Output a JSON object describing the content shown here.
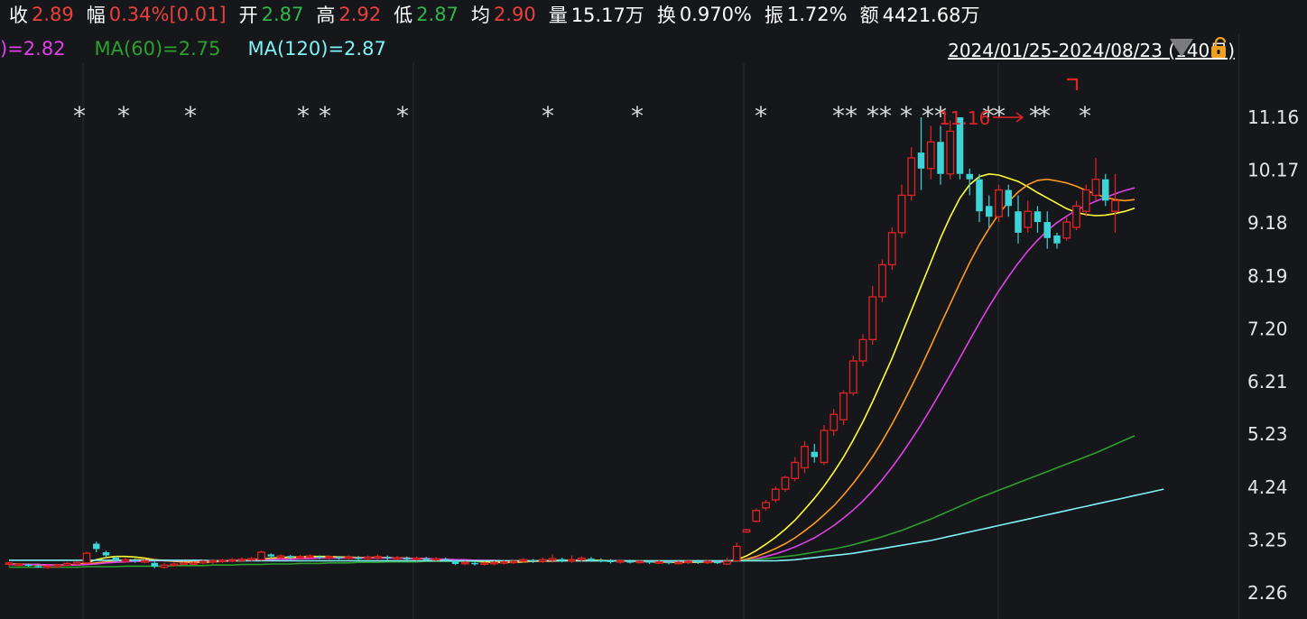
{
  "quote": {
    "close": {
      "label": "收",
      "value": "2.89"
    },
    "change": {
      "label": "幅",
      "value": "0.34%[0.01]"
    },
    "open": {
      "label": "开",
      "value": "2.87"
    },
    "high": {
      "label": "高",
      "value": "2.92"
    },
    "low": {
      "label": "低",
      "value": "2.87"
    },
    "avg": {
      "label": "均",
      "value": "2.90"
    },
    "volume": {
      "label": "量",
      "value": "15.17万"
    },
    "turnover": {
      "label": "换",
      "value": "0.970%"
    },
    "amplitude": {
      "label": "振",
      "value": "1.72%"
    },
    "amount": {
      "label": "额",
      "value": "4421.68万"
    }
  },
  "ma_labels": [
    {
      "text": ")=2.82",
      "color": "#e040e8"
    },
    {
      "text": "MA(60)=2.75",
      "color": "#2ca02c"
    },
    {
      "text": "MA(120)=2.87",
      "color": "#7ef3f7"
    }
  ],
  "range": {
    "label": "2024/01/25-2024/08/23 (140日)"
  },
  "colors": {
    "up": "#e02424",
    "down": "#3ed3d6",
    "up_value": "#e8413c",
    "down_value": "#2fb74a",
    "ma5": "#ffffff",
    "ma10": "#ffff33",
    "ma20": "#ff9a1f",
    "ma30": "#e040e8",
    "ma60": "#2ca02c",
    "ma120": "#7ef3f7",
    "grid": "#2a2b30",
    "marker": "#d8d8d8"
  },
  "chart_data": {
    "type": "candlestick",
    "y_ticks": [
      "11.16",
      "10.17",
      "9.18",
      "8.19",
      "7.20",
      "6.21",
      "5.23",
      "4.24",
      "3.25",
      "2.26"
    ],
    "ylim": [
      2.26,
      11.16
    ],
    "peak_annotation": "11.16",
    "markers": [
      1,
      3,
      6,
      11,
      12,
      16,
      22,
      26,
      31,
      34,
      35,
      36,
      37,
      38,
      39,
      40,
      41,
      42,
      43,
      44,
      45,
      46,
      47,
      48,
      49
    ],
    "candles": [
      [
        2.8,
        2.82,
        2.76,
        2.84
      ],
      [
        2.79,
        2.8,
        2.76,
        2.82
      ],
      [
        2.79,
        2.78,
        2.75,
        2.81
      ],
      [
        2.76,
        2.75,
        2.73,
        2.79
      ],
      [
        2.74,
        2.76,
        2.71,
        2.78
      ],
      [
        2.75,
        2.78,
        2.73,
        2.8
      ],
      [
        2.78,
        2.81,
        2.76,
        2.83
      ],
      [
        2.8,
        2.83,
        2.78,
        2.85
      ],
      [
        2.82,
        3.0,
        2.8,
        3.03
      ],
      [
        3.18,
        3.08,
        3.02,
        3.22
      ],
      [
        3.02,
        2.96,
        2.92,
        3.05
      ],
      [
        2.92,
        2.86,
        2.84,
        2.95
      ],
      [
        2.85,
        2.88,
        2.82,
        2.92
      ],
      [
        2.88,
        2.86,
        2.82,
        2.91
      ],
      [
        2.84,
        2.86,
        2.81,
        2.9
      ],
      [
        2.82,
        2.75,
        2.72,
        2.86
      ],
      [
        2.74,
        2.78,
        2.71,
        2.82
      ],
      [
        2.78,
        2.8,
        2.75,
        2.83
      ],
      [
        2.8,
        2.82,
        2.77,
        2.84
      ],
      [
        2.8,
        2.82,
        2.78,
        2.85
      ],
      [
        2.82,
        2.85,
        2.79,
        2.88
      ],
      [
        2.84,
        2.86,
        2.8,
        2.89
      ],
      [
        2.85,
        2.87,
        2.82,
        2.9
      ],
      [
        2.86,
        2.88,
        2.83,
        2.91
      ],
      [
        2.87,
        2.89,
        2.84,
        2.92
      ],
      [
        2.88,
        2.9,
        2.85,
        2.93
      ],
      [
        2.88,
        3.02,
        2.86,
        3.05
      ],
      [
        2.98,
        2.94,
        2.9,
        3.0
      ],
      [
        2.92,
        2.95,
        2.88,
        2.98
      ],
      [
        2.95,
        2.92,
        2.88,
        2.97
      ],
      [
        2.92,
        2.94,
        2.89,
        2.97
      ],
      [
        2.93,
        2.95,
        2.9,
        2.98
      ],
      [
        2.94,
        2.92,
        2.89,
        2.96
      ],
      [
        2.92,
        2.94,
        2.88,
        2.96
      ],
      [
        2.93,
        2.91,
        2.88,
        2.95
      ],
      [
        2.91,
        2.93,
        2.88,
        2.96
      ],
      [
        2.92,
        2.9,
        2.87,
        2.95
      ],
      [
        2.9,
        2.93,
        2.87,
        2.96
      ],
      [
        2.92,
        2.94,
        2.88,
        2.98
      ],
      [
        2.93,
        2.91,
        2.87,
        2.96
      ],
      [
        2.9,
        2.92,
        2.87,
        2.95
      ],
      [
        2.91,
        2.89,
        2.86,
        2.94
      ],
      [
        2.89,
        2.91,
        2.86,
        2.94
      ],
      [
        2.9,
        2.88,
        2.85,
        2.93
      ],
      [
        2.88,
        2.9,
        2.85,
        2.93
      ],
      [
        2.89,
        2.87,
        2.84,
        2.92
      ],
      [
        2.86,
        2.8,
        2.78,
        2.88
      ],
      [
        2.81,
        2.83,
        2.78,
        2.86
      ],
      [
        2.82,
        2.8,
        2.77,
        2.85
      ],
      [
        2.8,
        2.82,
        2.77,
        2.84
      ],
      [
        2.81,
        2.83,
        2.78,
        2.86
      ],
      [
        2.82,
        2.84,
        2.79,
        2.87
      ],
      [
        2.83,
        2.85,
        2.8,
        2.88
      ],
      [
        2.86,
        2.88,
        2.82,
        2.91
      ],
      [
        2.87,
        2.85,
        2.82,
        2.89
      ],
      [
        2.85,
        2.88,
        2.82,
        2.92
      ],
      [
        2.87,
        2.9,
        2.83,
        2.98
      ],
      [
        2.89,
        2.86,
        2.83,
        2.92
      ],
      [
        2.86,
        2.88,
        2.82,
        2.96
      ],
      [
        2.88,
        2.91,
        2.84,
        2.94
      ],
      [
        2.9,
        2.87,
        2.84,
        2.93
      ],
      [
        2.87,
        2.86,
        2.83,
        2.9
      ],
      [
        2.86,
        2.84,
        2.81,
        2.89
      ],
      [
        2.84,
        2.86,
        2.81,
        2.88
      ],
      [
        2.85,
        2.84,
        2.81,
        2.88
      ],
      [
        2.84,
        2.85,
        2.81,
        2.88
      ],
      [
        2.85,
        2.83,
        2.8,
        2.87
      ],
      [
        2.83,
        2.84,
        2.8,
        2.87
      ],
      [
        2.84,
        2.82,
        2.79,
        2.86
      ],
      [
        2.82,
        2.83,
        2.79,
        2.86
      ],
      [
        2.83,
        2.85,
        2.8,
        2.88
      ],
      [
        2.85,
        2.83,
        2.8,
        2.88
      ],
      [
        2.83,
        2.85,
        2.8,
        2.88
      ],
      [
        2.84,
        2.83,
        2.8,
        2.87
      ],
      [
        2.8,
        2.85,
        2.78,
        2.92
      ],
      [
        2.86,
        3.13,
        2.85,
        3.2
      ],
      [
        3.4,
        3.44,
        3.38,
        3.46
      ],
      [
        3.6,
        3.8,
        3.58,
        3.84
      ],
      [
        3.85,
        3.95,
        3.8,
        4.0
      ],
      [
        4.0,
        4.2,
        3.95,
        4.25
      ],
      [
        4.2,
        4.42,
        4.15,
        4.45
      ],
      [
        4.4,
        4.7,
        4.35,
        4.8
      ],
      [
        4.6,
        5.0,
        4.5,
        5.1
      ],
      [
        4.9,
        4.8,
        4.7,
        5.05
      ],
      [
        4.7,
        5.3,
        4.65,
        5.4
      ],
      [
        5.3,
        5.6,
        5.2,
        5.7
      ],
      [
        5.5,
        6.0,
        5.4,
        6.05
      ],
      [
        6.0,
        6.6,
        5.95,
        6.7
      ],
      [
        6.6,
        7.0,
        6.5,
        7.1
      ],
      [
        7.0,
        7.8,
        6.9,
        8.0
      ],
      [
        7.8,
        8.4,
        7.7,
        8.5
      ],
      [
        8.4,
        9.0,
        8.3,
        9.1
      ],
      [
        9.0,
        9.7,
        8.9,
        9.9
      ],
      [
        9.7,
        10.4,
        9.6,
        10.6
      ],
      [
        10.5,
        10.2,
        9.8,
        11.16
      ],
      [
        10.2,
        10.7,
        10.0,
        11.0
      ],
      [
        10.7,
        10.1,
        9.9,
        11.0
      ],
      [
        10.1,
        10.9,
        10.0,
        11.1
      ],
      [
        11.16,
        10.1,
        10.0,
        11.16
      ],
      [
        10.1,
        10.0,
        9.7,
        10.2
      ],
      [
        10.0,
        9.4,
        9.2,
        10.1
      ],
      [
        9.5,
        9.3,
        9.1,
        9.7
      ],
      [
        9.3,
        9.8,
        9.2,
        9.9
      ],
      [
        9.8,
        9.5,
        9.3,
        9.9
      ],
      [
        9.4,
        9.0,
        8.8,
        9.7
      ],
      [
        9.1,
        9.4,
        9.0,
        9.6
      ],
      [
        9.4,
        9.2,
        9.0,
        9.5
      ],
      [
        9.2,
        8.9,
        8.7,
        9.4
      ],
      [
        8.95,
        8.8,
        8.7,
        9.0
      ],
      [
        8.9,
        9.2,
        8.85,
        9.3
      ],
      [
        9.1,
        9.5,
        9.05,
        9.6
      ],
      [
        9.4,
        9.8,
        9.3,
        9.9
      ],
      [
        9.7,
        10.0,
        9.6,
        10.4
      ],
      [
        10.0,
        9.6,
        9.5,
        10.1
      ],
      [
        9.4,
        9.6,
        9.0,
        10.1
      ]
    ],
    "ma_series": [
      {
        "key": "ma10",
        "values": [
          2.8,
          2.8,
          2.79,
          2.79,
          2.78,
          2.78,
          2.78,
          2.79,
          2.82,
          2.88,
          2.92,
          2.94,
          2.94,
          2.93,
          2.91,
          2.88,
          2.86,
          2.85,
          2.84,
          2.83,
          2.83,
          2.84,
          2.85,
          2.86,
          2.87,
          2.88,
          2.89,
          2.91,
          2.92,
          2.93,
          2.93,
          2.94,
          2.94,
          2.94,
          2.93,
          2.93,
          2.92,
          2.92,
          2.92,
          2.92,
          2.91,
          2.91,
          2.9,
          2.9,
          2.89,
          2.88,
          2.87,
          2.86,
          2.85,
          2.84,
          2.83,
          2.83,
          2.83,
          2.84,
          2.85,
          2.86,
          2.87,
          2.87,
          2.87,
          2.87,
          2.87,
          2.87,
          2.86,
          2.86,
          2.85,
          2.85,
          2.84,
          2.84,
          2.83,
          2.83,
          2.83,
          2.83,
          2.84,
          2.84,
          2.85,
          2.88,
          2.95,
          3.05,
          3.17,
          3.3,
          3.45,
          3.62,
          3.82,
          4.03,
          4.26,
          4.52,
          4.8,
          5.12,
          5.46,
          5.84,
          6.24,
          6.65,
          7.1,
          7.55,
          8.0,
          8.45,
          8.9,
          9.3,
          9.65,
          9.9,
          10.05,
          10.1,
          10.08,
          10.02,
          9.96,
          9.86,
          9.75,
          9.65,
          9.55,
          9.45,
          9.38,
          9.34,
          9.32,
          9.33,
          9.36,
          9.4,
          9.46
        ]
      },
      {
        "key": "ma20",
        "values": [
          2.79,
          2.79,
          2.79,
          2.78,
          2.78,
          2.78,
          2.78,
          2.79,
          2.8,
          2.82,
          2.84,
          2.86,
          2.87,
          2.88,
          2.88,
          2.88,
          2.87,
          2.86,
          2.86,
          2.85,
          2.85,
          2.85,
          2.85,
          2.86,
          2.86,
          2.87,
          2.88,
          2.89,
          2.9,
          2.91,
          2.91,
          2.92,
          2.92,
          2.92,
          2.92,
          2.92,
          2.92,
          2.92,
          2.92,
          2.92,
          2.91,
          2.91,
          2.9,
          2.9,
          2.89,
          2.88,
          2.88,
          2.87,
          2.87,
          2.86,
          2.86,
          2.85,
          2.85,
          2.85,
          2.85,
          2.85,
          2.85,
          2.86,
          2.86,
          2.86,
          2.86,
          2.86,
          2.86,
          2.86,
          2.85,
          2.85,
          2.85,
          2.85,
          2.84,
          2.84,
          2.84,
          2.84,
          2.84,
          2.84,
          2.85,
          2.86,
          2.89,
          2.94,
          3.01,
          3.09,
          3.18,
          3.29,
          3.42,
          3.56,
          3.72,
          3.89,
          4.09,
          4.31,
          4.55,
          4.81,
          5.1,
          5.42,
          5.76,
          6.12,
          6.49,
          6.88,
          7.28,
          7.67,
          8.06,
          8.44,
          8.78,
          9.08,
          9.35,
          9.58,
          9.76,
          9.9,
          9.98,
          10.0,
          9.97,
          9.93,
          9.87,
          9.79,
          9.72,
          9.66,
          9.62,
          9.6,
          9.62
        ]
      },
      {
        "key": "ma30",
        "values": [
          2.79,
          2.79,
          2.79,
          2.79,
          2.78,
          2.78,
          2.78,
          2.78,
          2.79,
          2.8,
          2.82,
          2.83,
          2.84,
          2.85,
          2.85,
          2.86,
          2.86,
          2.86,
          2.86,
          2.86,
          2.86,
          2.86,
          2.86,
          2.86,
          2.87,
          2.87,
          2.88,
          2.88,
          2.89,
          2.89,
          2.9,
          2.9,
          2.91,
          2.91,
          2.91,
          2.91,
          2.91,
          2.91,
          2.91,
          2.91,
          2.91,
          2.9,
          2.9,
          2.9,
          2.89,
          2.89,
          2.88,
          2.88,
          2.87,
          2.87,
          2.87,
          2.86,
          2.86,
          2.86,
          2.86,
          2.86,
          2.86,
          2.86,
          2.86,
          2.86,
          2.86,
          2.86,
          2.86,
          2.86,
          2.86,
          2.85,
          2.85,
          2.85,
          2.85,
          2.85,
          2.85,
          2.85,
          2.85,
          2.85,
          2.85,
          2.86,
          2.87,
          2.9,
          2.94,
          2.99,
          3.05,
          3.12,
          3.2,
          3.29,
          3.4,
          3.52,
          3.66,
          3.81,
          3.98,
          4.17,
          4.38,
          4.61,
          4.86,
          5.13,
          5.41,
          5.71,
          6.02,
          6.34,
          6.66,
          6.99,
          7.31,
          7.62,
          7.91,
          8.18,
          8.43,
          8.66,
          8.86,
          9.04,
          9.19,
          9.31,
          9.42,
          9.51,
          9.59,
          9.66,
          9.73,
          9.79,
          9.84
        ]
      },
      {
        "key": "ma60",
        "values": [
          2.74,
          2.74,
          2.74,
          2.74,
          2.74,
          2.74,
          2.74,
          2.74,
          2.75,
          2.75,
          2.75,
          2.75,
          2.76,
          2.76,
          2.76,
          2.76,
          2.76,
          2.77,
          2.77,
          2.77,
          2.77,
          2.78,
          2.78,
          2.78,
          2.79,
          2.79,
          2.79,
          2.8,
          2.8,
          2.8,
          2.81,
          2.81,
          2.81,
          2.82,
          2.82,
          2.82,
          2.83,
          2.83,
          2.83,
          2.84,
          2.84,
          2.84,
          2.84,
          2.85,
          2.85,
          2.85,
          2.85,
          2.85,
          2.85,
          2.86,
          2.86,
          2.86,
          2.86,
          2.86,
          2.86,
          2.86,
          2.86,
          2.86,
          2.86,
          2.86,
          2.86,
          2.86,
          2.86,
          2.86,
          2.86,
          2.86,
          2.86,
          2.86,
          2.86,
          2.86,
          2.86,
          2.86,
          2.86,
          2.86,
          2.86,
          2.86,
          2.87,
          2.88,
          2.9,
          2.92,
          2.94,
          2.96,
          2.99,
          3.02,
          3.05,
          3.08,
          3.12,
          3.16,
          3.21,
          3.26,
          3.31,
          3.37,
          3.43,
          3.5,
          3.57,
          3.64,
          3.72,
          3.8,
          3.88,
          3.96,
          4.04,
          4.11,
          4.18,
          4.25,
          4.32,
          4.39,
          4.46,
          4.53,
          4.6,
          4.67,
          4.74,
          4.81,
          4.88,
          4.96,
          5.04,
          5.12,
          5.2
        ]
      },
      {
        "key": "ma120",
        "values": [
          2.87,
          2.87,
          2.87,
          2.87,
          2.87,
          2.87,
          2.87,
          2.87,
          2.87,
          2.87,
          2.87,
          2.87,
          2.87,
          2.87,
          2.87,
          2.87,
          2.87,
          2.87,
          2.87,
          2.87,
          2.87,
          2.86,
          2.86,
          2.86,
          2.86,
          2.86,
          2.86,
          2.86,
          2.86,
          2.86,
          2.86,
          2.86,
          2.86,
          2.86,
          2.86,
          2.86,
          2.86,
          2.86,
          2.86,
          2.86,
          2.86,
          2.86,
          2.86,
          2.86,
          2.86,
          2.86,
          2.86,
          2.86,
          2.86,
          2.86,
          2.86,
          2.86,
          2.86,
          2.86,
          2.86,
          2.86,
          2.86,
          2.86,
          2.86,
          2.86,
          2.86,
          2.86,
          2.86,
          2.86,
          2.86,
          2.86,
          2.86,
          2.86,
          2.86,
          2.86,
          2.86,
          2.86,
          2.86,
          2.86,
          2.86,
          2.86,
          2.86,
          2.86,
          2.86,
          2.86,
          2.87,
          2.88,
          2.9,
          2.92,
          2.94,
          2.96,
          2.98,
          3.0,
          3.03,
          3.06,
          3.09,
          3.12,
          3.15,
          3.18,
          3.21,
          3.24,
          3.28,
          3.32,
          3.36,
          3.4,
          3.44,
          3.48,
          3.52,
          3.56,
          3.6,
          3.64,
          3.68,
          3.72,
          3.76,
          3.8,
          3.84,
          3.88,
          3.92,
          3.96,
          4.0,
          4.04,
          4.08,
          4.12,
          4.16,
          4.2
        ]
      }
    ]
  }
}
